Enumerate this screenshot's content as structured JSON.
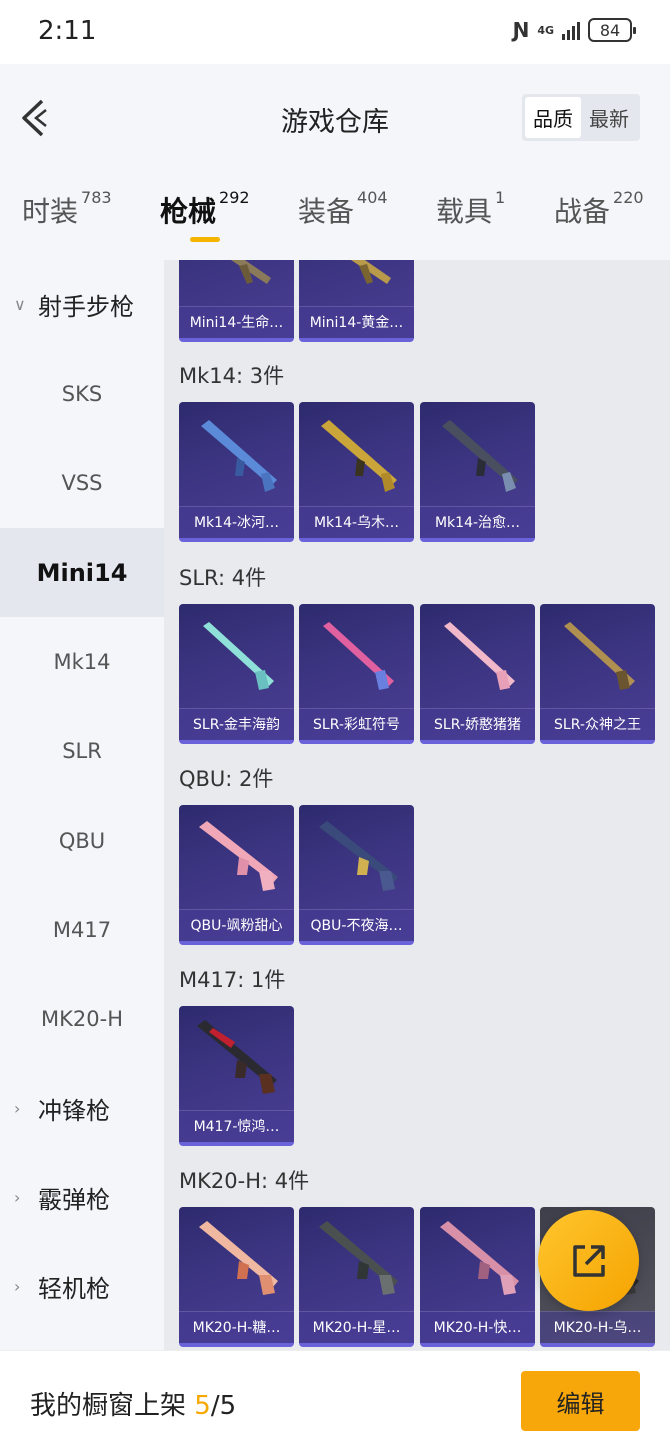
{
  "status_bar": {
    "time": "2:11",
    "network": "4G",
    "battery": "84"
  },
  "header": {
    "title": "游戏仓库",
    "sort_quality": "品质",
    "sort_newest": "最新"
  },
  "tabs": [
    {
      "label": "时装",
      "count": "783"
    },
    {
      "label": "枪械",
      "count": "292"
    },
    {
      "label": "装备",
      "count": "404"
    },
    {
      "label": "载具",
      "count": "1"
    },
    {
      "label": "战备",
      "count": "220"
    }
  ],
  "sidebar": {
    "group_open": "射手步枪",
    "items": [
      "SKS",
      "VSS",
      "Mini14",
      "Mk14",
      "SLR",
      "QBU",
      "M417",
      "MK20-H"
    ],
    "selected": "Mini14",
    "groups_closed": [
      "冲锋枪",
      "霰弹枪",
      "轻机枪"
    ]
  },
  "sections": [
    {
      "title": "",
      "items": [
        "Mini14-生命…",
        "Mini14-黄金…"
      ]
    },
    {
      "title": "Mk14: 3件",
      "items": [
        "Mk14-冰河…",
        "Mk14-乌木…",
        "Mk14-治愈…"
      ]
    },
    {
      "title": "SLR: 4件",
      "items": [
        "SLR-金丰海韵",
        "SLR-彩虹符号",
        "SLR-娇憨猪猪",
        "SLR-众神之王"
      ]
    },
    {
      "title": "QBU: 2件",
      "items": [
        "QBU-飒粉甜心",
        "QBU-不夜海…"
      ]
    },
    {
      "title": "M417: 1件",
      "items": [
        "M417-惊鸿…"
      ]
    },
    {
      "title": "MK20-H: 4件",
      "items": [
        "MK20-H-糖…",
        "MK20-H-星…",
        "MK20-H-快…",
        "MK20-H-乌…"
      ]
    }
  ],
  "bottom": {
    "shelf_label": "我的橱窗上架 ",
    "shelf_current": "5",
    "shelf_total": "/5",
    "edit_label": "编辑"
  },
  "icons": {
    "back": "chevron-left-icon",
    "fab": "share-external-icon"
  },
  "colors": {
    "accent": "#f5a800",
    "card": "#3b3480"
  }
}
